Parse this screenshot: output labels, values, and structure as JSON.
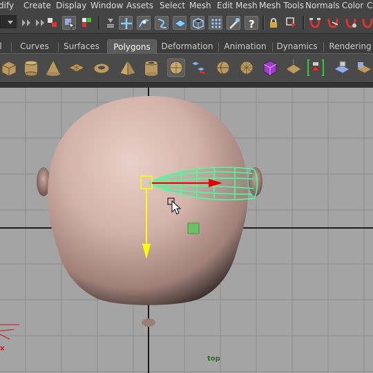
{
  "menu": [
    "dify",
    "Create",
    "Display",
    "Window",
    "Assets",
    "Select",
    "Mesh",
    "Edit Mesh",
    "Mesh Tools",
    "Normals",
    "Color",
    "C"
  ],
  "shelf_tabs": [
    {
      "label": "l",
      "active": false
    },
    {
      "label": "Curves",
      "active": false
    },
    {
      "label": "Surfaces",
      "active": false
    },
    {
      "label": "Polygons",
      "active": true
    },
    {
      "label": "Deformation",
      "active": false
    },
    {
      "label": "Animation",
      "active": false
    },
    {
      "label": "Dynamics",
      "active": false
    },
    {
      "label": "Rendering",
      "active": false
    }
  ],
  "status_icons": [
    "mode-dropdown-icon",
    "select-hierarchy-icon",
    "select-object-icon",
    "select-component-icon",
    "snap-grid-icon",
    "snap-curve-icon",
    "snap-point-icon",
    "snap-view-plane-icon",
    "make-live-icon",
    "history-icon",
    "render-icon",
    "ipr-icon",
    "render-settings-icon"
  ],
  "shelf_icons": [
    "poly-cube-icon",
    "poly-cylinder-icon",
    "poly-cone-icon",
    "poly-plane-icon",
    "poly-torus-icon",
    "poly-pyramid-icon",
    "poly-pipe-icon",
    "combine-icon",
    "separate-icon",
    "smooth-icon",
    "extract-icon",
    "boolean-icon",
    "mirror-icon",
    "subdiv-proxy-icon",
    "bevel-icon",
    "extrude-icon",
    "bridge-icon",
    "append-icon"
  ],
  "viewport": {
    "camera_label": "top",
    "axis_label": "x",
    "colors": {
      "background": "#a4a4a4",
      "grid": "#8c8c8c",
      "axis": "#1a1a1a",
      "selection": "#4dff99",
      "manip_x": "#e00000",
      "manip_y": "#ffff00"
    }
  }
}
